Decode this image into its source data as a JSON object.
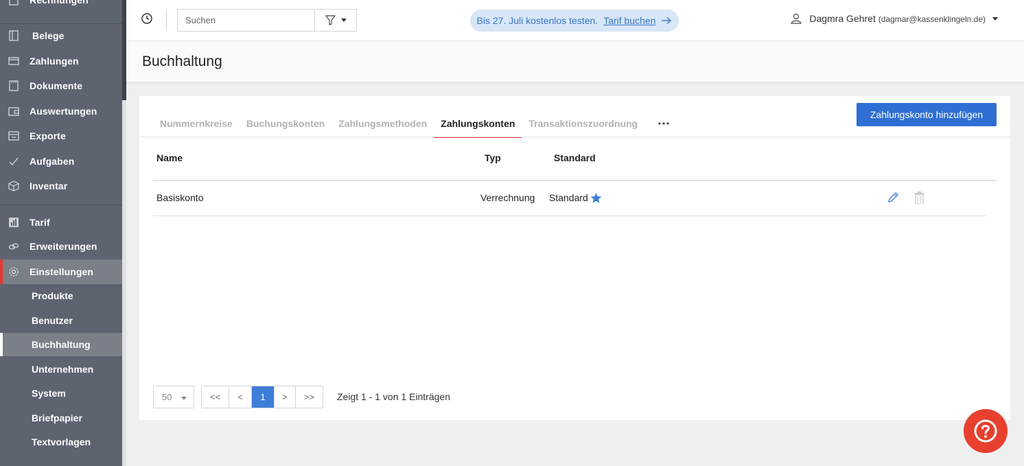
{
  "sidebar": {
    "items": [
      {
        "label": "Rechnungen",
        "icon": "invoice-icon"
      },
      {
        "label": "Belege",
        "icon": "receipt-icon"
      },
      {
        "label": "Zahlungen",
        "icon": "credit-card-icon"
      },
      {
        "label": "Dokumente",
        "icon": "document-icon"
      },
      {
        "label": "Auswertungen",
        "icon": "wallet-icon"
      },
      {
        "label": "Exporte",
        "icon": "export-icon"
      },
      {
        "label": "Aufgaben",
        "icon": "check-icon"
      },
      {
        "label": "Inventar",
        "icon": "box-icon"
      },
      {
        "label": "Tarif",
        "icon": "bar-chart-icon"
      },
      {
        "label": "Erweiterungen",
        "icon": "link-icon"
      },
      {
        "label": "Einstellungen",
        "icon": "gear-icon"
      }
    ],
    "subitems": [
      {
        "label": "Produkte"
      },
      {
        "label": "Benutzer"
      },
      {
        "label": "Buchhaltung"
      },
      {
        "label": "Unternehmen"
      },
      {
        "label": "System"
      },
      {
        "label": "Briefpapier"
      },
      {
        "label": "Textvorlagen"
      }
    ],
    "active_item": "Einstellungen",
    "active_subitem": "Buchhaltung",
    "accent_color": "#e43a2c"
  },
  "topbar": {
    "search_placeholder": "Suchen",
    "trial_text": "Bis 27. Juli kostenlos testen.",
    "trial_link": "Tarif buchen",
    "user_name": "Dagmra Gehret",
    "user_email": "(dagmar@kassenklingeln.de)"
  },
  "page": {
    "title": "Buchhaltung"
  },
  "tabs": [
    {
      "label": "Nummernkreise"
    },
    {
      "label": "Buchungskonten"
    },
    {
      "label": "Zahlungsmethoden"
    },
    {
      "label": "Zahlungskonten"
    },
    {
      "label": "Transaktionszuordnung"
    }
  ],
  "active_tab": "Zahlungskonten",
  "add_button_label": "Zahlungskonto hinzufügen",
  "table": {
    "headers": {
      "name": "Name",
      "type": "Typ",
      "standard": "Standard"
    },
    "rows": [
      {
        "name": "Basiskonto",
        "type": "Verrechnung",
        "standard": "Standard"
      }
    ]
  },
  "pagination": {
    "page_size": "50",
    "first": "<<",
    "prev": "<",
    "current": "1",
    "next": ">",
    "last": ">>",
    "info": "Zeigt 1 - 1 von 1 Einträgen"
  },
  "colors": {
    "primary": "#2f6fd4",
    "danger": "#e8402f",
    "sidebar_bg": "#5d6470"
  }
}
